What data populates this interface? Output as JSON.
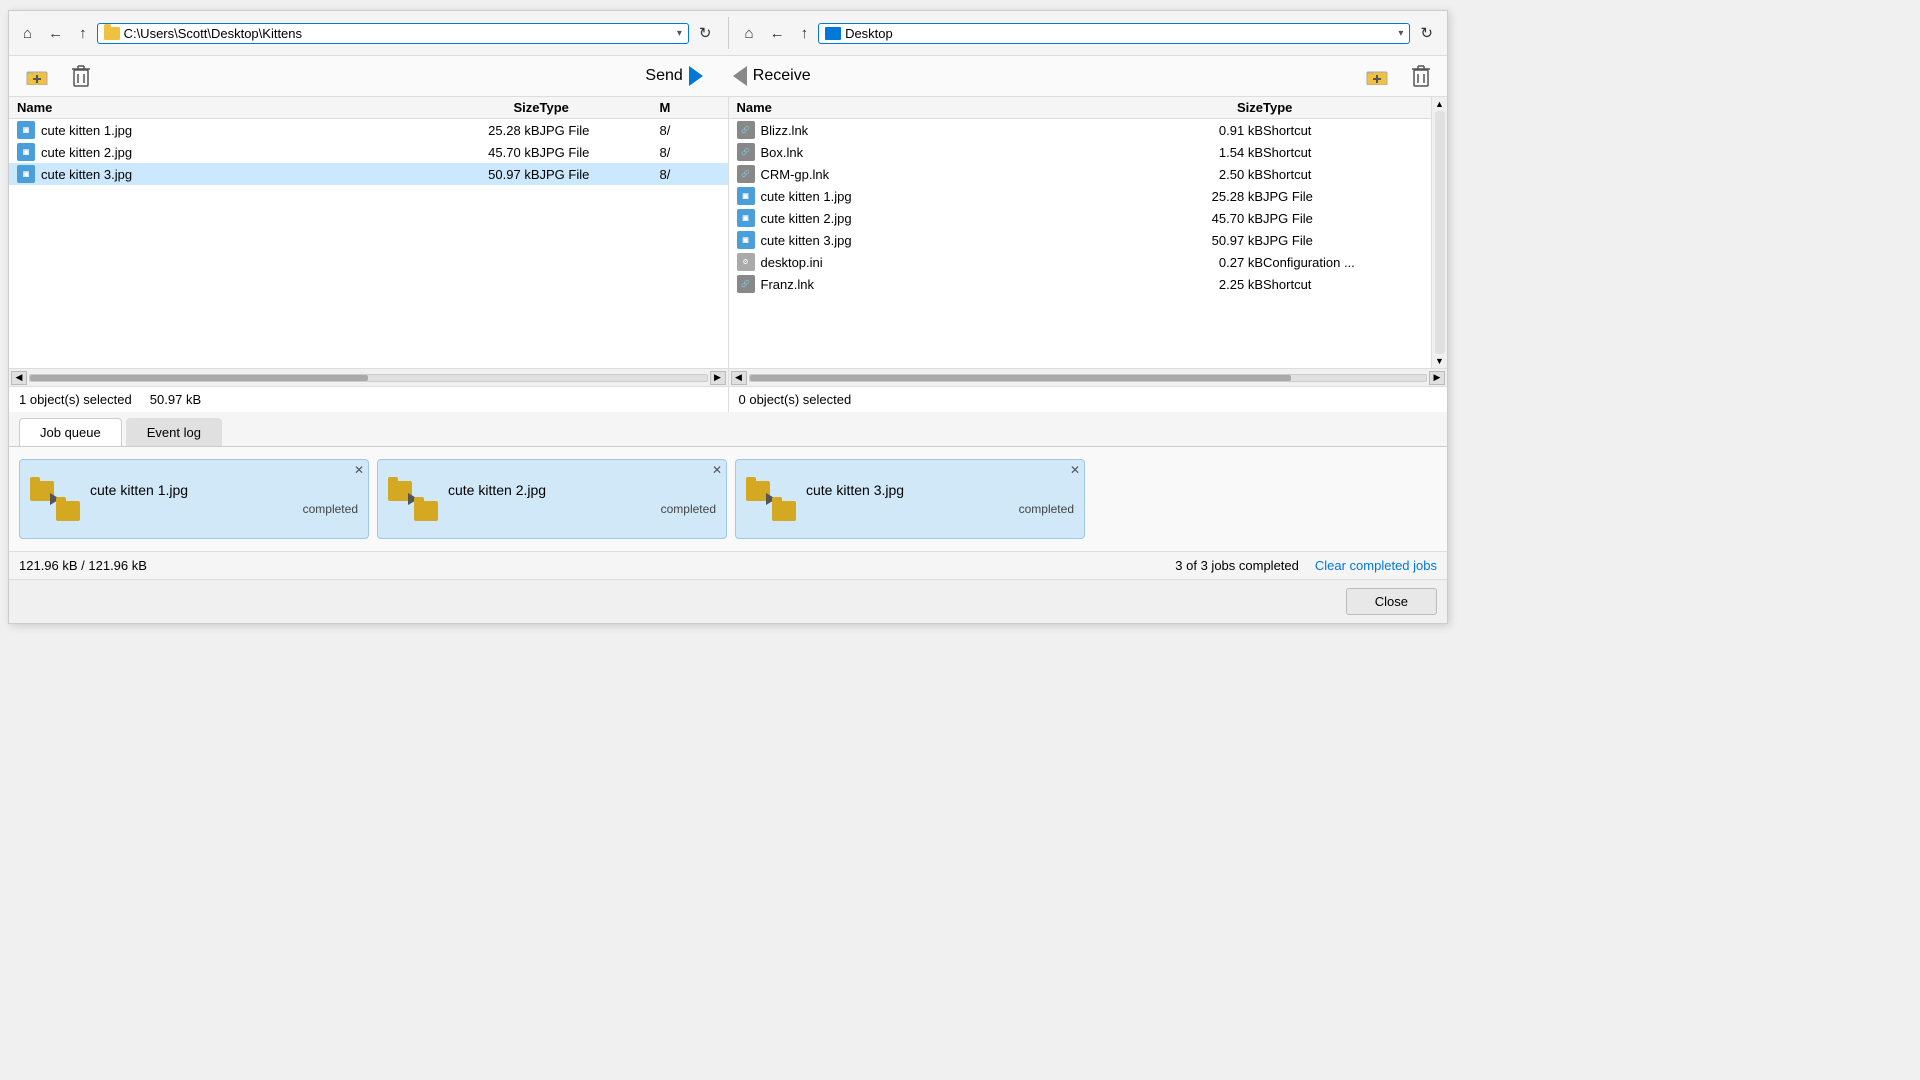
{
  "left_pane": {
    "address": "C:\\Users\\Scott\\Desktop\\Kittens",
    "columns": [
      "Name",
      "Size",
      "Type",
      "M"
    ],
    "files": [
      {
        "name": "cute kitten 1.jpg",
        "size": "25.28 kB",
        "type": "JPG File",
        "modified": "8/",
        "icon": "jpg",
        "selected": false
      },
      {
        "name": "cute kitten 2.jpg",
        "size": "45.70 kB",
        "type": "JPG File",
        "modified": "8/",
        "icon": "jpg",
        "selected": false
      },
      {
        "name": "cute kitten 3.jpg",
        "size": "50.97 kB",
        "type": "JPG File",
        "modified": "8/",
        "icon": "jpg",
        "selected": true
      }
    ],
    "status": "1 object(s) selected",
    "size": "50.97 kB"
  },
  "right_pane": {
    "address": "Desktop",
    "columns": [
      "Name",
      "Size",
      "Type"
    ],
    "files": [
      {
        "name": "Blizz.lnk",
        "size": "0.91 kB",
        "type": "Shortcut",
        "icon": "lnk"
      },
      {
        "name": "Box.lnk",
        "size": "1.54 kB",
        "type": "Shortcut",
        "icon": "lnk"
      },
      {
        "name": "CRM-gp.lnk",
        "size": "2.50 kB",
        "type": "Shortcut",
        "icon": "lnk"
      },
      {
        "name": "cute kitten 1.jpg",
        "size": "25.28 kB",
        "type": "JPG File",
        "icon": "jpg"
      },
      {
        "name": "cute kitten 2.jpg",
        "size": "45.70 kB",
        "type": "JPG File",
        "icon": "jpg"
      },
      {
        "name": "cute kitten 3.jpg",
        "size": "50.97 kB",
        "type": "JPG File",
        "icon": "jpg"
      },
      {
        "name": "desktop.ini",
        "size": "0.27 kB",
        "type": "Configuration ...",
        "icon": "ini"
      },
      {
        "name": "Franz.lnk",
        "size": "2.25 kB",
        "type": "Shortcut",
        "icon": "lnk"
      }
    ],
    "status": "0 object(s) selected"
  },
  "toolbar": {
    "send_label": "Send",
    "receive_label": "Receive"
  },
  "tabs": [
    {
      "label": "Job queue",
      "active": true
    },
    {
      "label": "Event log",
      "active": false
    }
  ],
  "jobs": [
    {
      "name": "cute kitten 1.jpg",
      "status": "completed"
    },
    {
      "name": "cute kitten 2.jpg",
      "status": "completed"
    },
    {
      "name": "cute kitten 3.jpg",
      "status": "completed"
    }
  ],
  "bottom": {
    "transfer_size": "121.96 kB / 121.96 kB",
    "jobs_completed": "3 of 3 jobs completed",
    "clear_label": "Clear completed jobs"
  },
  "close_button": "Close"
}
